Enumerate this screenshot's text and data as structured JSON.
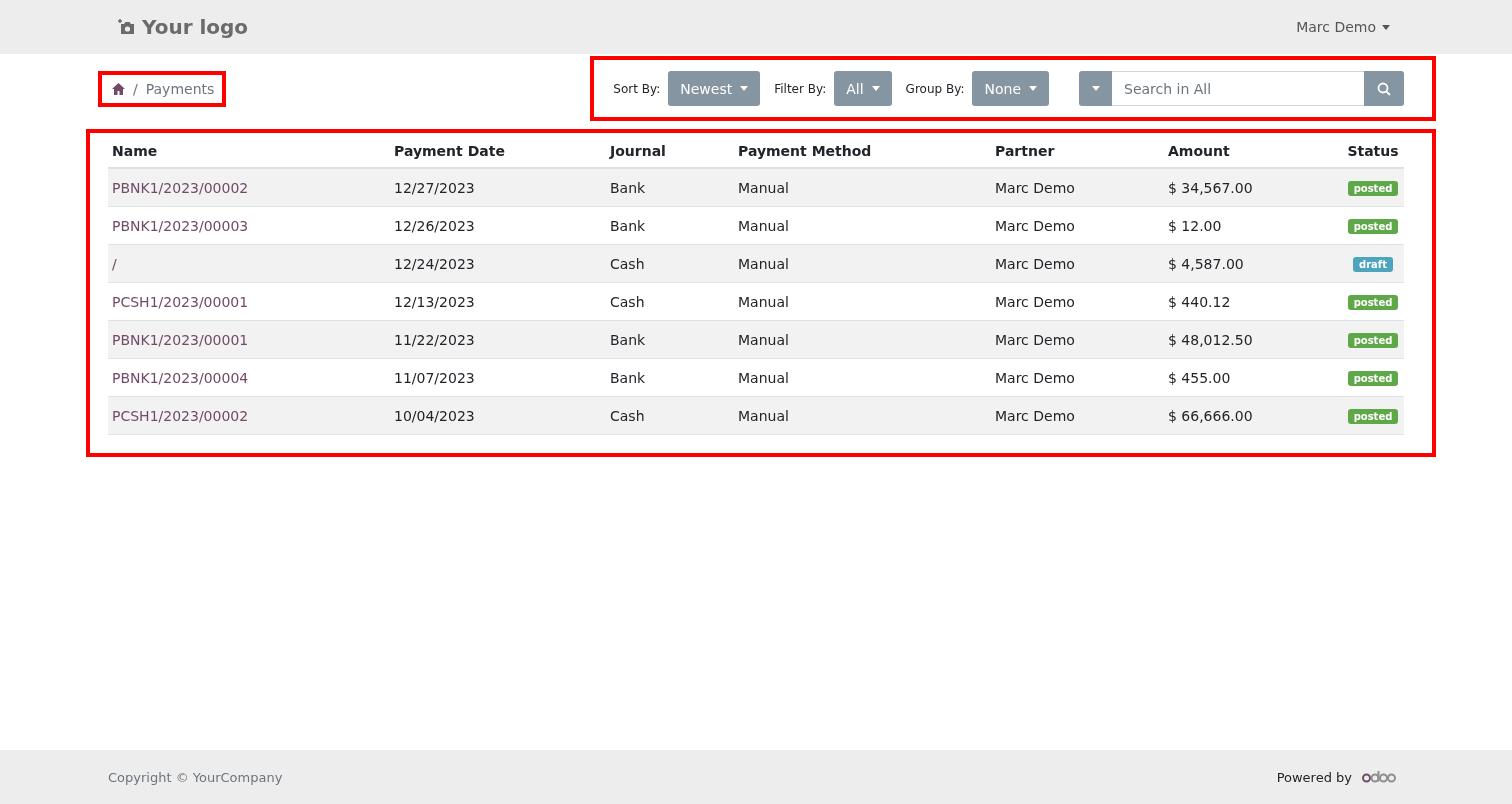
{
  "header": {
    "logo": "Your logo",
    "user": "Marc Demo"
  },
  "breadcrumb": {
    "separator": "/",
    "items": [
      "Payments"
    ]
  },
  "toolbar": {
    "controls": [
      {
        "label": "Sort By:",
        "value": "Newest"
      },
      {
        "label": "Filter By:",
        "value": "All"
      },
      {
        "label": "Group By:",
        "value": "None"
      }
    ],
    "search": {
      "placeholder": "Search in All"
    }
  },
  "table": {
    "columns": [
      "Name",
      "Payment Date",
      "Journal",
      "Payment Method",
      "Partner",
      "Amount",
      "Status"
    ],
    "rows": [
      {
        "name": "PBNK1/2023/00002",
        "date": "12/27/2023",
        "journal": "Bank",
        "method": "Manual",
        "partner": "Marc Demo",
        "amount": "$ 34,567.00",
        "status": "posted",
        "color": "#5fa84a"
      },
      {
        "name": "PBNK1/2023/00003",
        "date": "12/26/2023",
        "journal": "Bank",
        "method": "Manual",
        "partner": "Marc Demo",
        "amount": "$ 12.00",
        "status": "posted",
        "color": "#5fa84a"
      },
      {
        "name": "/",
        "date": "12/24/2023",
        "journal": "Cash",
        "method": "Manual",
        "partner": "Marc Demo",
        "amount": "$ 4,587.00",
        "status": "draft",
        "color": "#4ea4bd"
      },
      {
        "name": "PCSH1/2023/00001",
        "date": "12/13/2023",
        "journal": "Cash",
        "method": "Manual",
        "partner": "Marc Demo",
        "amount": "$ 440.12",
        "status": "posted",
        "color": "#5fa84a"
      },
      {
        "name": "PBNK1/2023/00001",
        "date": "11/22/2023",
        "journal": "Bank",
        "method": "Manual",
        "partner": "Marc Demo",
        "amount": "$ 48,012.50",
        "status": "posted",
        "color": "#5fa84a"
      },
      {
        "name": "PBNK1/2023/00004",
        "date": "11/07/2023",
        "journal": "Bank",
        "method": "Manual",
        "partner": "Marc Demo",
        "amount": "$ 455.00",
        "status": "posted",
        "color": "#5fa84a"
      },
      {
        "name": "PCSH1/2023/00002",
        "date": "10/04/2023",
        "journal": "Cash",
        "method": "Manual",
        "partner": "Marc Demo",
        "amount": "$ 66,666.00",
        "status": "posted",
        "color": "#5fa84a"
      }
    ]
  },
  "footer": {
    "copyright": "Copyright © YourCompany",
    "powered": "Powered by"
  }
}
